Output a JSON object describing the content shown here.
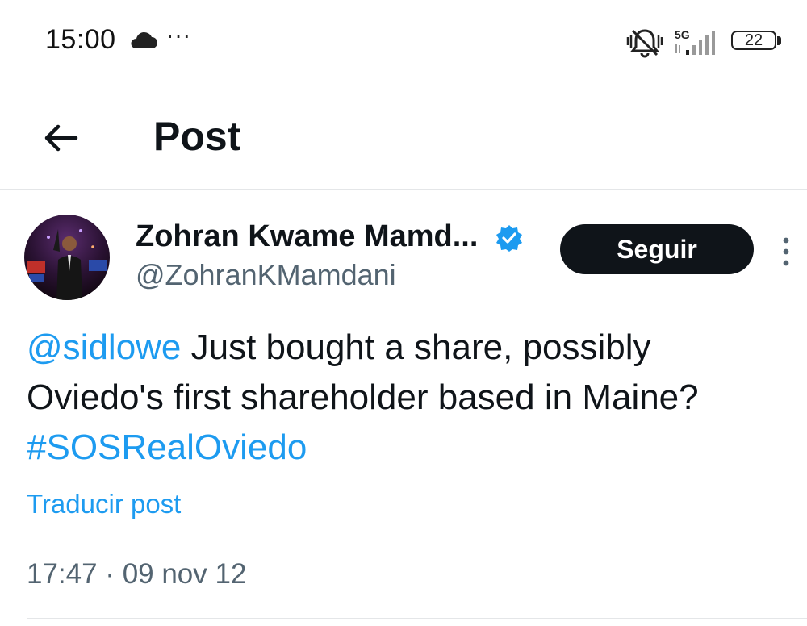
{
  "status_bar": {
    "time": "15:00",
    "overflow": "···",
    "network": "5G",
    "battery": "22",
    "icons": [
      "cloud-icon",
      "bell-muted-icon",
      "signal-icon",
      "battery-icon"
    ]
  },
  "header": {
    "back_icon": "arrow-left-icon",
    "title": "Post"
  },
  "author": {
    "display_name": "Zohran Kwame Mamd...",
    "handle": "@ZohranKMamdani",
    "verified": true,
    "follow_label": "Seguir"
  },
  "post": {
    "mention": "@sidlowe",
    "text": " Just bought a share, possibly Oviedo's first shareholder based in Maine?",
    "hashtag": "#SOSRealOviedo",
    "translate_label": "Traducir post",
    "timestamp": "17:47 · 09 nov 12"
  },
  "colors": {
    "link": "#1d9bf0",
    "follow_bg": "#0f1419",
    "secondary_text": "#536471",
    "verified": "#1d9bf0"
  }
}
